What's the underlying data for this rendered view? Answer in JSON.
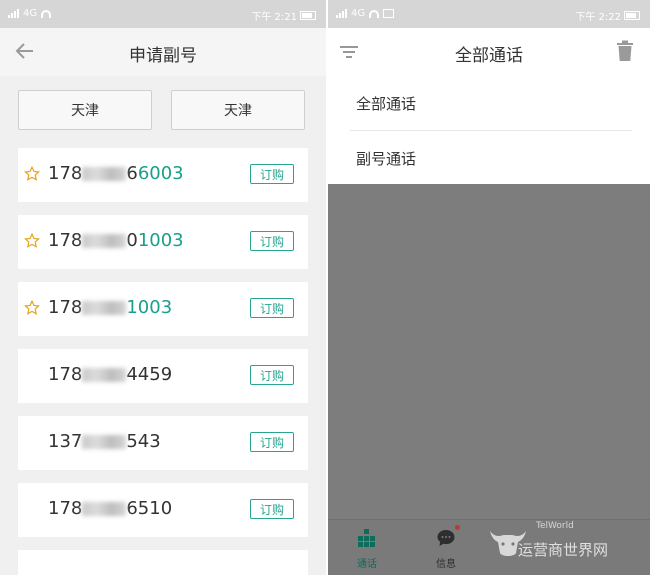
{
  "left_screen": {
    "status": {
      "network": "4G",
      "time": "下午 2:21"
    },
    "header": {
      "title": "申请副号"
    },
    "cities": [
      "天津",
      "天津"
    ],
    "numbers": [
      {
        "prefix": "178",
        "visible_tail": "6",
        "highlight": "6003",
        "starred": true,
        "action": "订购"
      },
      {
        "prefix": "178",
        "visible_tail": "0",
        "highlight": "1003",
        "starred": true,
        "action": "订购"
      },
      {
        "prefix": "178",
        "visible_tail": "",
        "highlight": "1003",
        "starred": true,
        "action": "订购"
      },
      {
        "prefix": "178",
        "visible_tail": "4459",
        "highlight": "",
        "starred": false,
        "action": "订购"
      },
      {
        "prefix": "137",
        "visible_tail": "543",
        "highlight": "",
        "starred": false,
        "action": "订购"
      },
      {
        "prefix": "178",
        "visible_tail": "6510",
        "highlight": "",
        "starred": false,
        "action": "订购"
      }
    ]
  },
  "right_screen": {
    "status": {
      "network": "4G",
      "time": "下午 2:22"
    },
    "header": {
      "title": "全部通话"
    },
    "menu": [
      "全部通话",
      "副号通话"
    ],
    "tabs": [
      {
        "label": "通话",
        "icon": "dialpad-icon",
        "active": true
      },
      {
        "label": "信息",
        "icon": "message-icon",
        "active": false
      }
    ],
    "watermark": {
      "small": "TelWorld",
      "large": "运营商世界网"
    }
  },
  "colors": {
    "accent": "#27a590",
    "highlight_number": "#1aa08a",
    "overlay": "#7d7d7d"
  }
}
